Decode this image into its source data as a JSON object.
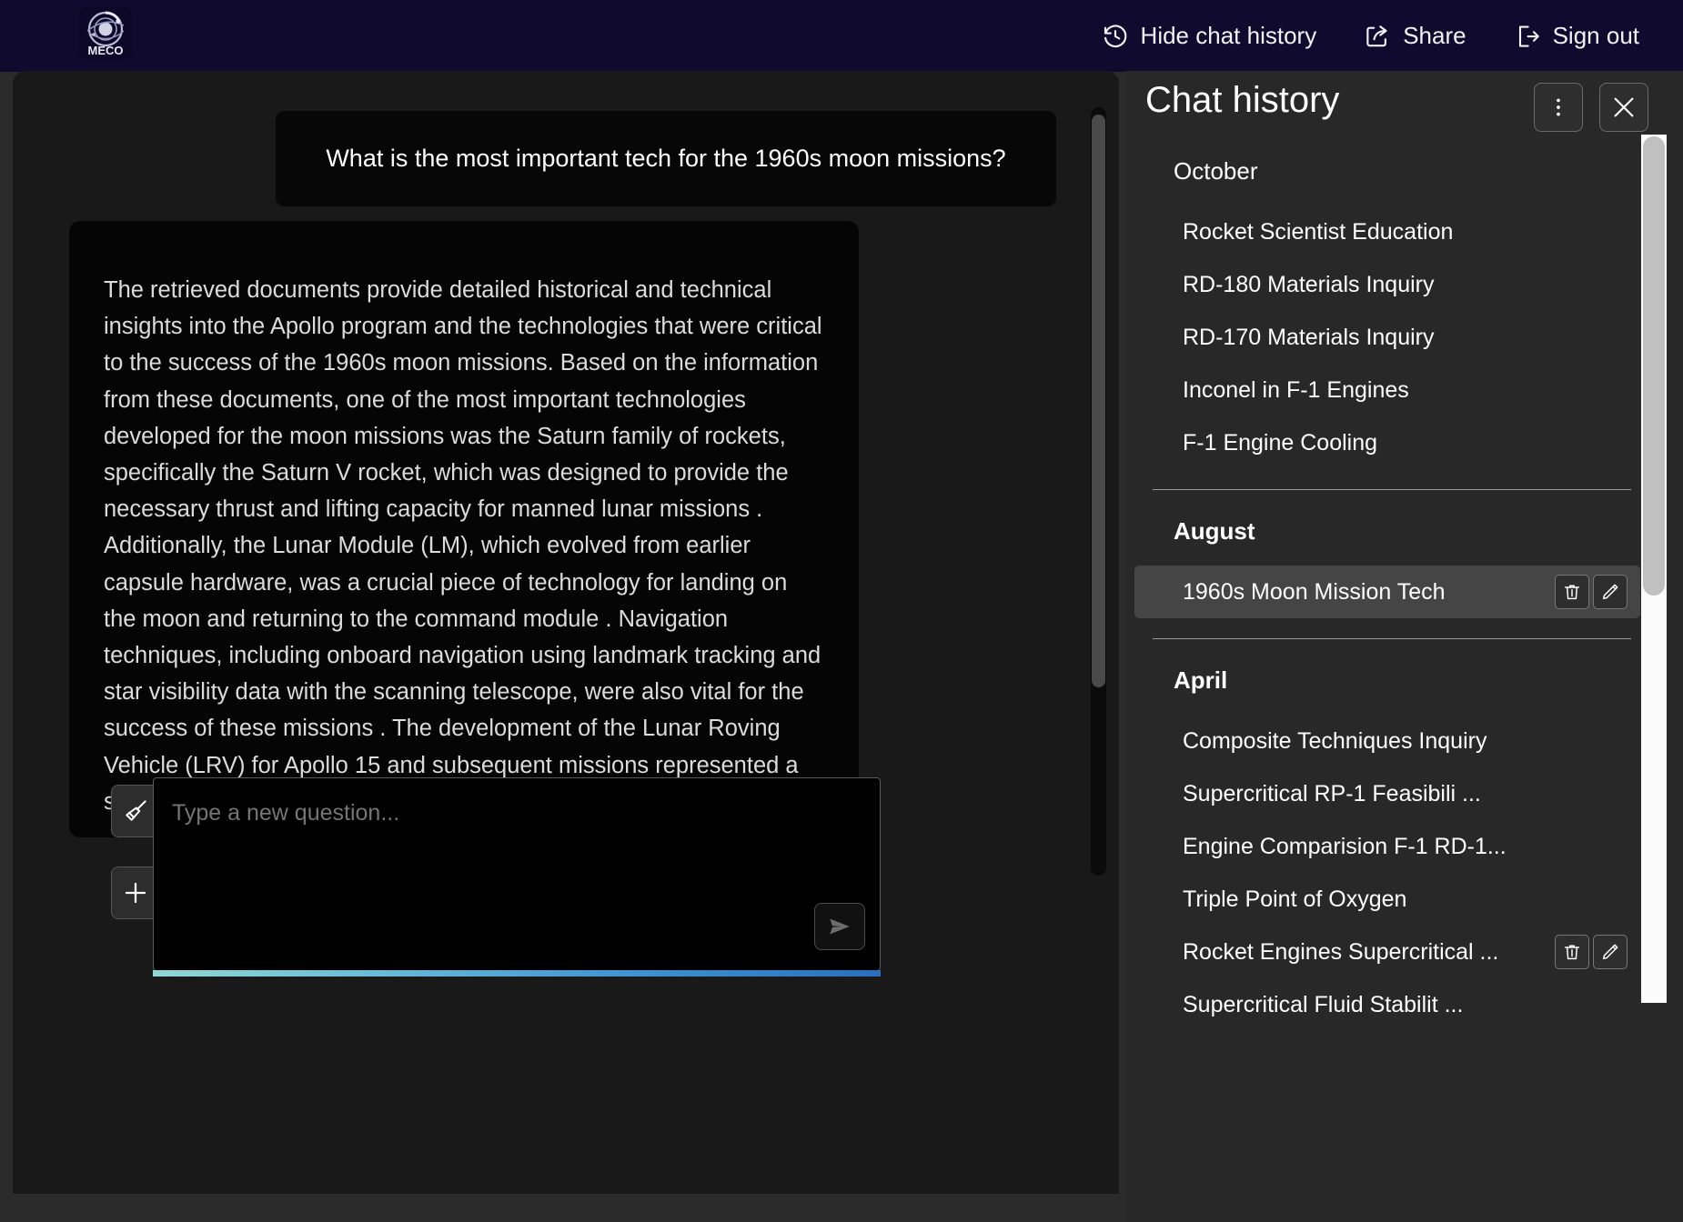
{
  "header": {
    "logo_text": "MECO",
    "actions": [
      {
        "label": "Hide chat history",
        "icon": "history-clock-icon"
      },
      {
        "label": "Share",
        "icon": "share-icon"
      },
      {
        "label": "Sign out",
        "icon": "sign-out-icon"
      }
    ]
  },
  "chat": {
    "question": "What is the most important tech for the 1960s moon missions?",
    "answer": "The retrieved documents provide detailed historical and technical insights into the Apollo program and the technologies that were critical to the success of the 1960s moon missions. Based on the information from these documents, one of the most important technologies developed for the moon missions was the Saturn family of rockets, specifically the Saturn V rocket, which was designed to provide the necessary thrust and lifting capacity for manned lunar missions . Additionally, the Lunar Module (LM), which evolved from earlier capsule hardware, was a crucial piece of technology for landing on the moon and returning to the command module . Navigation techniques, including onboard navigation using landmark tracking and star visibility data with the scanning telescope, were also vital for the success of these missions . The development of the Lunar Roving Vehicle (LRV) for Apollo 15 and subsequent missions represented a significant technological advancement, allowing"
  },
  "composer": {
    "placeholder": "Type a new question...",
    "value": "",
    "clear_icon": "broom-icon",
    "add_icon": "plus-icon",
    "send_icon": "send-arrow-icon"
  },
  "history": {
    "title": "Chat history",
    "menu_icon": "more-vertical-icon",
    "close_icon": "close-icon",
    "groups": [
      {
        "label": "October",
        "items": [
          {
            "label": "Rocket Scientist Education",
            "selected": false,
            "actions": false
          },
          {
            "label": "RD-180 Materials Inquiry",
            "selected": false,
            "actions": false
          },
          {
            "label": "RD-170 Materials Inquiry",
            "selected": false,
            "actions": false
          },
          {
            "label": "Inconel in F-1 Engines",
            "selected": false,
            "actions": false
          },
          {
            "label": "F-1 Engine Cooling",
            "selected": false,
            "actions": false
          }
        ]
      },
      {
        "label": "August",
        "items": [
          {
            "label": "1960s Moon Mission Tech",
            "selected": true,
            "actions": true
          }
        ]
      },
      {
        "label": "April",
        "items": [
          {
            "label": "Composite Techniques Inquiry",
            "selected": false,
            "actions": false
          },
          {
            "label": "Supercritical RP-1 Feasibili ...",
            "selected": false,
            "actions": false
          },
          {
            "label": "Engine Comparision F-1 RD-1...",
            "selected": false,
            "actions": false
          },
          {
            "label": "Triple Point of Oxygen",
            "selected": false,
            "actions": false
          },
          {
            "label": "Rocket Engines Supercritical ...",
            "selected": false,
            "actions": true
          },
          {
            "label": "Supercritical Fluid Stabilit ...",
            "selected": false,
            "actions": false
          }
        ]
      }
    ],
    "row_delete_icon": "trash-icon",
    "row_edit_icon": "pencil-icon"
  },
  "colors": {
    "header_bg": "#100a2e",
    "page_bg": "#2b2b2b",
    "chat_bg": "#191919",
    "bubble_bg": "#050505",
    "panel_bg": "#282828",
    "selected_row": "#454545",
    "accent_gradient_start": "#8fd9d4",
    "accent_gradient_end": "#2a6fc0"
  }
}
